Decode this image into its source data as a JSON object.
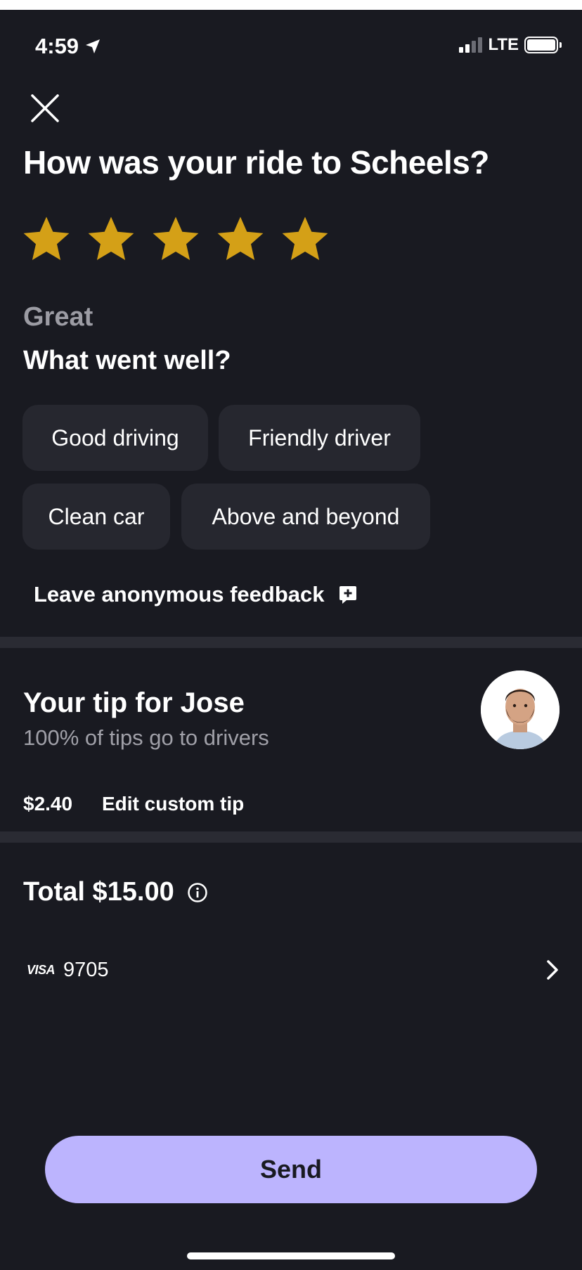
{
  "status_bar": {
    "time": "4:59",
    "network": "LTE"
  },
  "title": "How was your ride to Scheels?",
  "rating": {
    "stars": 5,
    "max": 5,
    "label": "Great"
  },
  "feedback": {
    "heading": "What went well?",
    "chips": [
      "Good driving",
      "Friendly driver",
      "Clean car",
      "Above and beyond"
    ],
    "anonymous_link": "Leave anonymous feedback"
  },
  "tip": {
    "heading": "Your tip for Jose",
    "subtext": "100% of tips go to drivers",
    "amount": "$2.40",
    "edit_label": "Edit custom tip"
  },
  "total": {
    "label": "Total $15.00"
  },
  "payment": {
    "brand": "VISA",
    "last4": "9705"
  },
  "send_button": "Send",
  "colors": {
    "background": "#191a21",
    "chip": "#26272f",
    "star": "#d4a017",
    "accent": "#bcb4fe",
    "muted": "#9c9ca4"
  }
}
